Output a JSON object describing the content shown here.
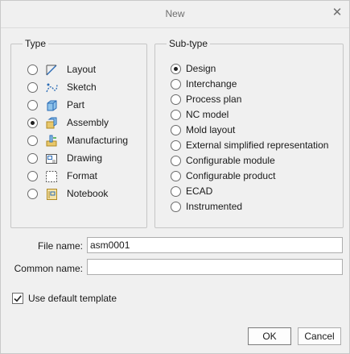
{
  "window": {
    "title": "New"
  },
  "type_group": {
    "label": "Type",
    "items": [
      {
        "label": "Layout",
        "icon": "layout-icon",
        "selected": false
      },
      {
        "label": "Sketch",
        "icon": "sketch-icon",
        "selected": false
      },
      {
        "label": "Part",
        "icon": "part-icon",
        "selected": false
      },
      {
        "label": "Assembly",
        "icon": "assembly-icon",
        "selected": true
      },
      {
        "label": "Manufacturing",
        "icon": "manufacturing-icon",
        "selected": false
      },
      {
        "label": "Drawing",
        "icon": "drawing-icon",
        "selected": false
      },
      {
        "label": "Format",
        "icon": "format-icon",
        "selected": false
      },
      {
        "label": "Notebook",
        "icon": "notebook-icon",
        "selected": false
      }
    ]
  },
  "subtype_group": {
    "label": "Sub-type",
    "items": [
      {
        "label": "Design",
        "selected": true
      },
      {
        "label": "Interchange",
        "selected": false
      },
      {
        "label": "Process plan",
        "selected": false
      },
      {
        "label": "NC model",
        "selected": false
      },
      {
        "label": "Mold layout",
        "selected": false
      },
      {
        "label": "External simplified representation",
        "selected": false
      },
      {
        "label": "Configurable module",
        "selected": false
      },
      {
        "label": "Configurable product",
        "selected": false
      },
      {
        "label": "ECAD",
        "selected": false
      },
      {
        "label": "Instrumented",
        "selected": false
      }
    ]
  },
  "file_name": {
    "label": "File name:",
    "value": "asm0001"
  },
  "common_name": {
    "label": "Common name:",
    "value": ""
  },
  "default_template": {
    "label": "Use default template",
    "checked": true
  },
  "buttons": {
    "ok": "OK",
    "cancel": "Cancel"
  },
  "colors": {
    "dialog_bg": "#f0f0f0",
    "icon_blue": "#2a6bb5",
    "icon_gold": "#c9a33a"
  }
}
